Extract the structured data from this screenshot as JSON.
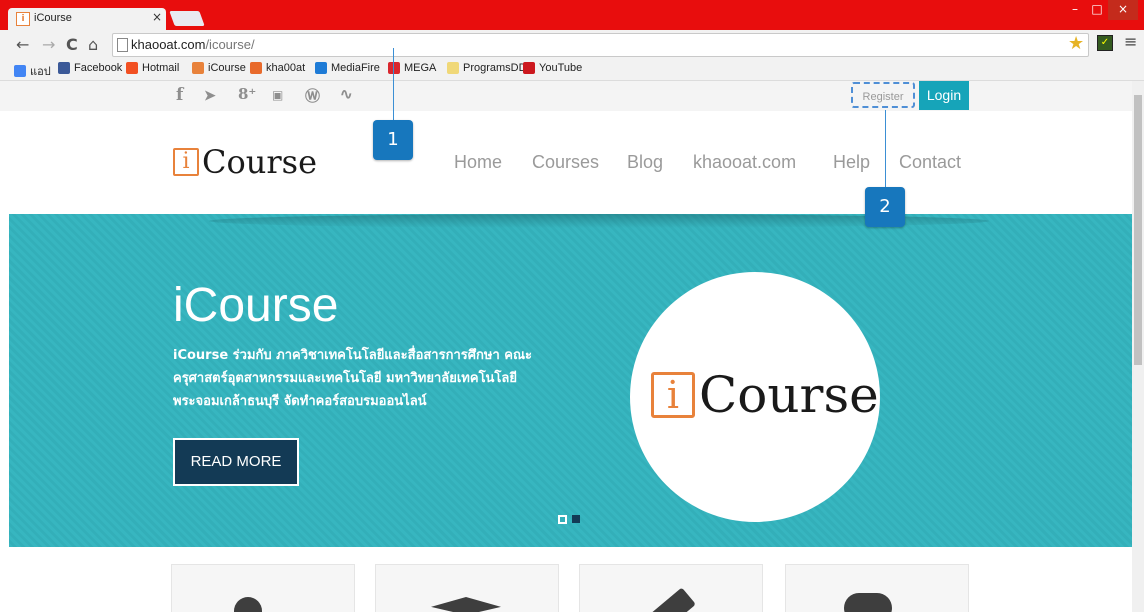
{
  "browser": {
    "tab_title": "iCourse",
    "tab_close": "×",
    "tab_favicon": "i",
    "window_buttons": [
      "–",
      "□",
      "×"
    ],
    "url_host": "khaooat.com",
    "url_path": "/icourse/",
    "nav_icons": [
      "back-icon",
      "forward-icon",
      "reload-icon",
      "home-icon"
    ],
    "bookmarks": [
      {
        "label": "แอป",
        "icon": "apps-icon",
        "color": "#4285f4"
      },
      {
        "label": "Facebook",
        "icon": "facebook-icon",
        "color": "#3b5998"
      },
      {
        "label": "Hotmail",
        "icon": "hotmail-icon",
        "color": "#f25022"
      },
      {
        "label": "iCourse",
        "icon": "icourse-icon",
        "color": "#e8823b"
      },
      {
        "label": "kha00at",
        "icon": "kha00at-icon",
        "color": "#e86a2b"
      },
      {
        "label": "MediaFire",
        "icon": "mediafire-icon",
        "color": "#1e7bd6"
      },
      {
        "label": "MEGA",
        "icon": "mega-icon",
        "color": "#d9272e"
      },
      {
        "label": "ProgramsDD",
        "icon": "folder-icon",
        "color": "#f0d878"
      },
      {
        "label": "YouTube",
        "icon": "youtube-icon",
        "color": "#cc181e"
      }
    ]
  },
  "site": {
    "social_icons": [
      "facebook-icon",
      "twitter-icon",
      "googleplus-icon",
      "youtube-icon",
      "wordpress-icon",
      "rss-icon"
    ],
    "social_glyphs": [
      "f",
      "🐦",
      "8⁺",
      "▶",
      "Ⓦ",
      "ᯤ"
    ],
    "register_label": "Register",
    "login_label": "Login",
    "logo_i": "i",
    "logo_text": "Course",
    "nav": [
      "Home",
      "Courses",
      "Blog",
      "khaooat.com",
      "Help",
      "Contact"
    ],
    "hero": {
      "title": "iCourse",
      "text": "iCourse ร่วมกับ ภาควิชาเทคโนโลยีและสื่อสารการศึกษา คณะครุศาสตร์อุตสาหกรรมและเทคโนโลยี มหาวิทยาลัยเทคโนโลยีพระจอมเกล้าธนบุรี จัดทำคอร์สอบรมออนไลน์",
      "button": "READ MORE",
      "circle_logo_i": "i",
      "circle_logo_text": "Course",
      "slide_count": 2,
      "active_slide": 2
    },
    "features": [
      "users-icon",
      "graduation-cap-icon",
      "pencil-icon",
      "chat-icon"
    ]
  },
  "annotations": {
    "callout_1": "1",
    "callout_2": "2"
  },
  "colors": {
    "accent": "#16a4b9",
    "hero_bg": "#35b3bd",
    "button_bg": "#133a55",
    "callout": "#1777bd",
    "chrome_red": "#e80d0d",
    "logo_orange": "#e8823b"
  }
}
